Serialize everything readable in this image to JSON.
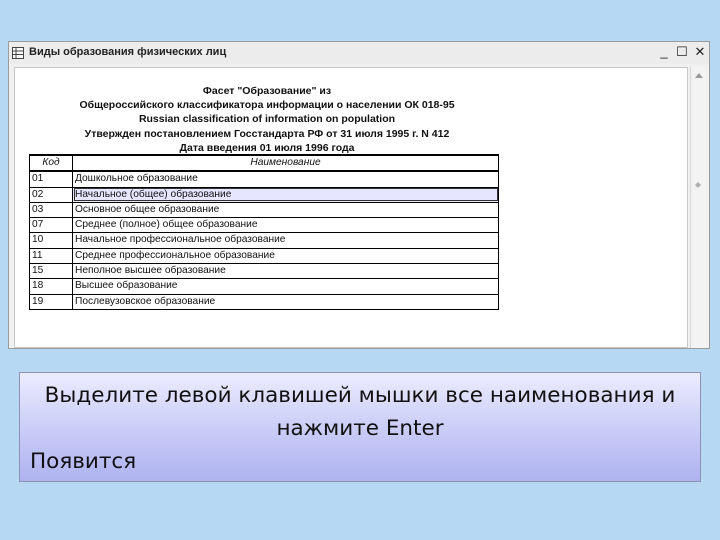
{
  "window": {
    "title": "Виды образования физических лиц",
    "minimize_symbol": "_",
    "maximize_symbol": "☐",
    "close_symbol": "✕"
  },
  "document": {
    "header_lines": [
      "Фасет \"Образование\" из",
      "Общероссийского классификатора информации о населении ОК  018-95",
      "Russian classification of information on population",
      "Утвержден постановлением Госстандарта РФ от 31 июля 1995 г. N 412",
      "Дата введения 01 июля 1996 года"
    ],
    "columns": [
      "Код",
      "Наименование"
    ],
    "rows": [
      {
        "code": "01",
        "name": "Дошкольное образование"
      },
      {
        "code": "02",
        "name": "Начальное (общее) образование"
      },
      {
        "code": "03",
        "name": "Основное общее образование"
      },
      {
        "code": "07",
        "name": "Среднее (полное) общее образование"
      },
      {
        "code": "10",
        "name": "Начальное профессиональное образование"
      },
      {
        "code": "11",
        "name": "Среднее профессиональное образование"
      },
      {
        "code": "15",
        "name": "Неполное высшее образование"
      },
      {
        "code": "18",
        "name": "Высшее образование"
      },
      {
        "code": "19",
        "name": "Послевузовское образование"
      }
    ],
    "selected_row_code": "02"
  },
  "instruction": {
    "line1": "Выделите левой клавишей мышки все наименования и",
    "line2": "нажмите Enter",
    "line3": "Появится"
  }
}
